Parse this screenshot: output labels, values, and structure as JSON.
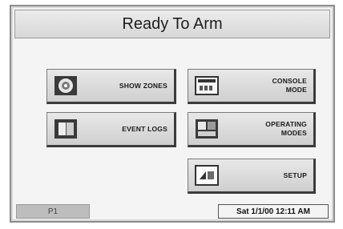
{
  "title": "Ready To Arm",
  "buttons": {
    "show_zones": {
      "label": "SHOW ZONES",
      "icon": "eye-icon"
    },
    "event_logs": {
      "label": "EVENT LOGS",
      "icon": "book-icon"
    },
    "console_mode": {
      "line1": "CONSOLE",
      "line2": "MODE",
      "icon": "keypad-icon"
    },
    "operating_modes": {
      "line1": "OPERATING",
      "line2": "MODES",
      "icon": "mode-icon"
    },
    "setup": {
      "label": "SETUP",
      "icon": "setup-icon"
    }
  },
  "status": {
    "partition": "P1",
    "datetime": "Sat 1/1/00 12:11 AM"
  }
}
